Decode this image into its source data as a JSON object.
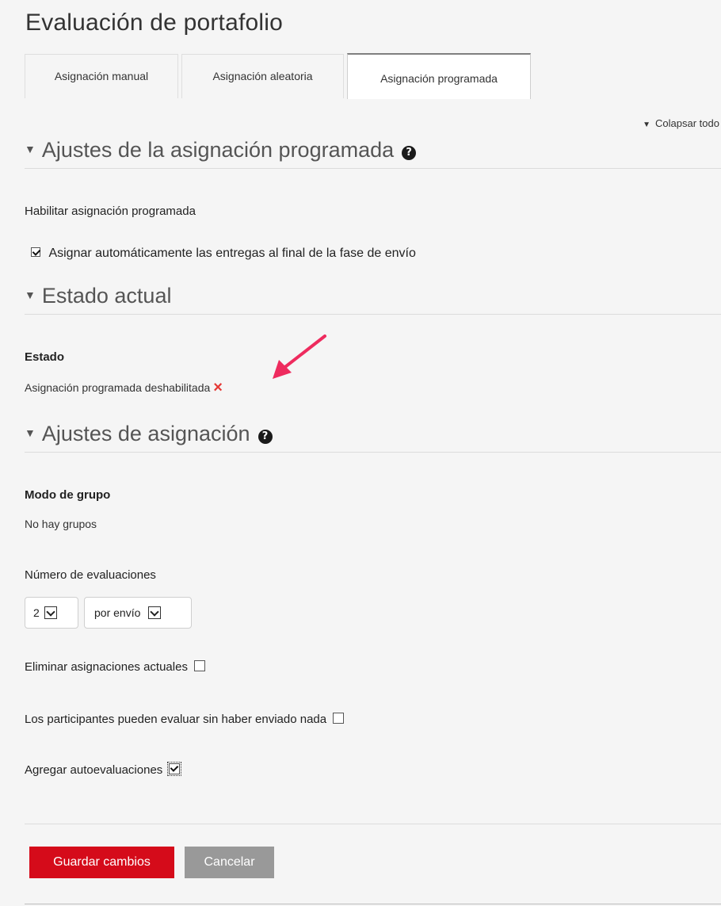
{
  "page": {
    "title": "Evaluación de portafolio"
  },
  "tabs": [
    {
      "label": "Asignación manual",
      "active": false
    },
    {
      "label": "Asignación aleatoria",
      "active": false
    },
    {
      "label": "Asignación programada",
      "active": true
    }
  ],
  "collapse_all": "Colapsar todo",
  "sections": {
    "scheduled": {
      "title": "Ajustes de la asignación programada",
      "enable_label": "Habilitar asignación programada",
      "auto_assign_label": "Asignar automáticamente las entregas al final de la fase de envío",
      "auto_assign_checked": true
    },
    "status": {
      "title": "Estado actual",
      "label": "Estado",
      "value": "Asignación programada deshabilitada",
      "status_icon": "×",
      "accent": "#e53935"
    },
    "settings": {
      "title": "Ajustes de asignación",
      "group_mode_label": "Modo de grupo",
      "group_mode_value": "No hay grupos",
      "num_reviews_label": "Número de evaluaciones",
      "num_reviews_value": "2",
      "per_value": "por envío",
      "remove_current_label": "Eliminar asignaciones actuales",
      "remove_current_checked": false,
      "without_submission_label": "Los participantes pueden evaluar sin haber enviado nada",
      "without_submission_checked": false,
      "self_assessment_label": "Agregar autoevaluaciones",
      "self_assessment_checked": true
    }
  },
  "buttons": {
    "save": "Guardar cambios",
    "cancel": "Cancelar"
  },
  "colors": {
    "primary": "#d50b1a",
    "secondary": "#999999",
    "annotation_arrow": "#ee2b5e"
  }
}
